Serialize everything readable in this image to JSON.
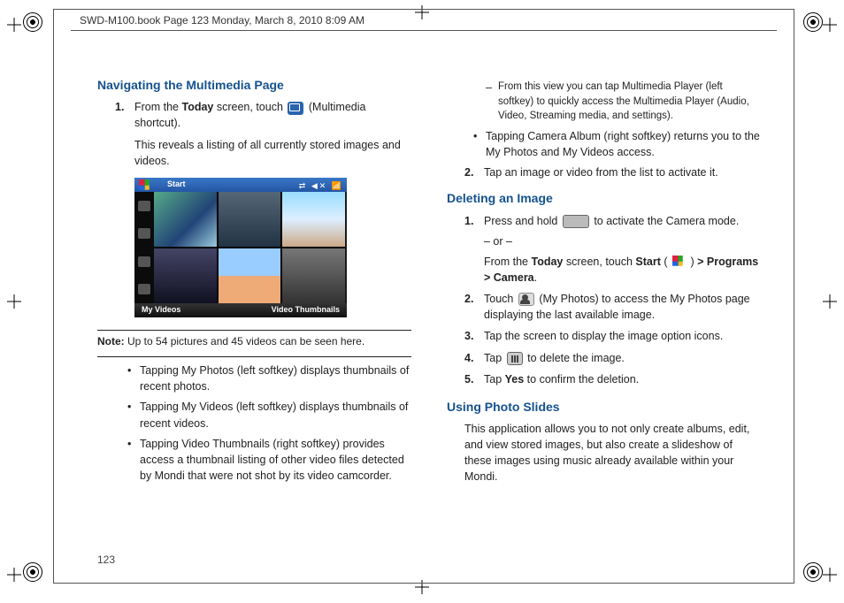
{
  "header": "SWD-M100.book  Page 123  Monday, March 8, 2010  8:09 AM",
  "page_number": "123",
  "left": {
    "heading": "Navigating the Multimedia Page",
    "step1_num": "1.",
    "step1_a": "From the ",
    "step1_today": "Today",
    "step1_b": " screen, touch ",
    "step1_c": " (Multimedia shortcut).",
    "step1_line2": "This reveals a listing of all currently stored images and videos.",
    "ss_start": "Start",
    "ss_right": "⇄ ◀✕ 📶",
    "ss_left_label": "My Videos",
    "ss_right_label": "Video Thumbnails",
    "note_label": "Note:",
    "note_text": " Up to 54 pictures and 45 videos can be seen here.",
    "bul1": "Tapping My Photos (left softkey) displays thumbnails of recent photos.",
    "bul2": "Tapping My Videos (left softkey) displays thumbnails of recent videos.",
    "bul3": "Tapping Video Thumbnails (right softkey) provides access a thumbnail listing of other video files detected by Mondi that were not shot by its video camcorder."
  },
  "right": {
    "sub1": "From this view you can tap Multimedia Player (left softkey) to quickly access the Multimedia Player (Audio, Video, Streaming media, and settings).",
    "bul_cam": "Tapping Camera Album (right softkey) returns you to the My Photos and My Videos access.",
    "step2_num": "2.",
    "step2": "Tap an image or video from the list to activate it.",
    "del_heading": "Deleting an Image",
    "d1_num": "1.",
    "d1_a": "Press and hold ",
    "d1_b": " to activate the Camera mode.",
    "d1_or": "– or –",
    "d1_c1": "From the ",
    "d1_today": "Today",
    "d1_c2": " screen, touch ",
    "d1_start": "Start",
    "d1_c3": " ( ",
    "d1_c4": " ) ",
    "d1_gt": "> Programs > Camera",
    "d1_dot": ".",
    "d2_num": "2.",
    "d2_a": "Touch ",
    "d2_b": " (My Photos) to access the My Photos page displaying the last available image.",
    "d3_num": "3.",
    "d3": "Tap the screen to display the image option icons.",
    "d4_num": "4.",
    "d4_a": "Tap ",
    "d4_b": " to delete the image.",
    "d5_num": "5.",
    "d5_a": "Tap ",
    "d5_yes": "Yes",
    "d5_b": " to confirm the deletion.",
    "ups_heading": "Using Photo Slides",
    "ups_body": "This application allows you to not only create albums, edit, and view stored images, but also create a slideshow of these images using music already available within your Mondi."
  }
}
